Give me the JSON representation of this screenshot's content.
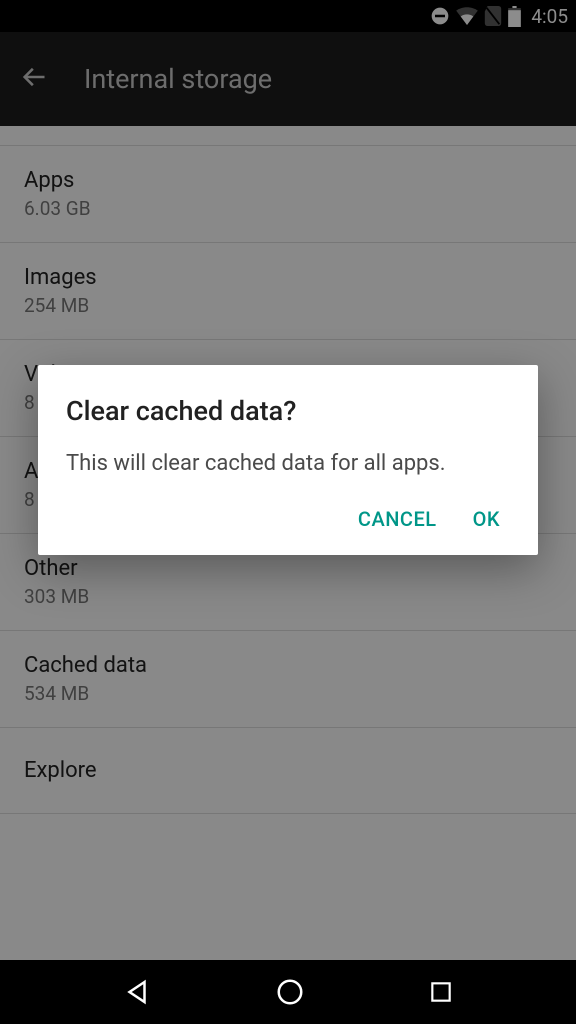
{
  "status": {
    "time": "4:05"
  },
  "header": {
    "title": "Internal storage"
  },
  "items": [
    {
      "title": "Apps",
      "sub": "6.03 GB"
    },
    {
      "title": "Images",
      "sub": "254 MB"
    },
    {
      "title": "Videos",
      "sub": "8"
    },
    {
      "title": "Audio",
      "sub": "8"
    },
    {
      "title": "Other",
      "sub": "303 MB"
    },
    {
      "title": "Cached data",
      "sub": "534 MB"
    },
    {
      "title": "Explore",
      "sub": ""
    }
  ],
  "dialog": {
    "title": "Clear cached data?",
    "body": "This will clear cached data for all apps.",
    "cancel": "CANCEL",
    "ok": "OK"
  }
}
